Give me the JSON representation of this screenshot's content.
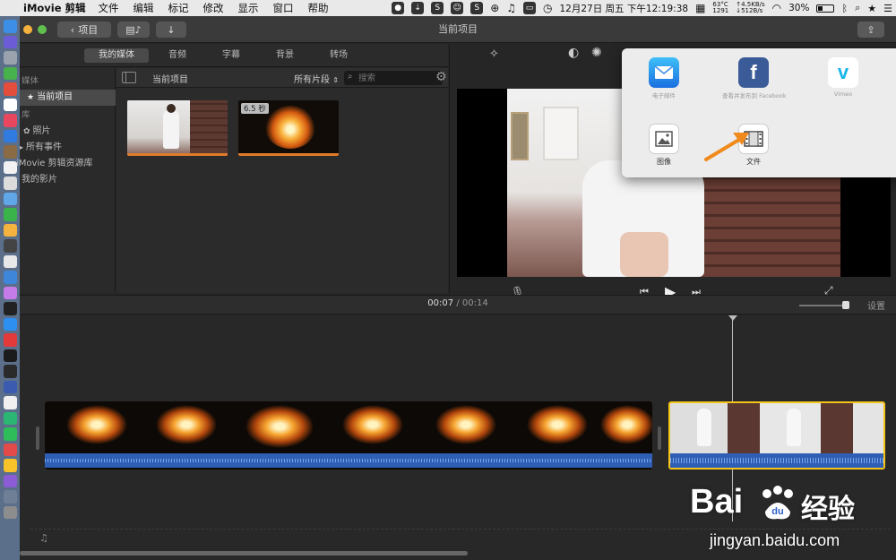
{
  "menubar": {
    "app_name": "iMovie 剪辑",
    "menus": [
      "文件",
      "编辑",
      "标记",
      "修改",
      "显示",
      "窗口",
      "帮助"
    ],
    "temperature": "63°C",
    "fan": "1291",
    "net_up": "↑4.5KB/s",
    "net_down": "↓512B/s",
    "battery": "30%",
    "clock": "12月27日 周五 下午12:19:38"
  },
  "toolbar": {
    "back_label": "项目",
    "window_title": "当前项目"
  },
  "media_tabs": [
    "我的媒体",
    "音频",
    "字幕",
    "背景",
    "转场"
  ],
  "library": {
    "section_media": "媒体",
    "current_project": "当前项目",
    "section_library": "库",
    "photos": "照片",
    "all_events": "所有事件",
    "imovie_library": "iMovie 剪辑资源库",
    "my_movies": "我的影片"
  },
  "browser": {
    "title": "当前项目",
    "filter": "所有片段",
    "search_placeholder": "搜索",
    "clip2_badge": "6.5 秒"
  },
  "share_popover": {
    "options": [
      {
        "label": "电子邮件",
        "icon": "mail-icon"
      },
      {
        "label": "查看并发布到 Facebook",
        "icon": "facebook-icon"
      },
      {
        "label": "Vimeo",
        "icon": "vimeo-icon"
      },
      {
        "label": "图像",
        "icon": "image-icon"
      },
      {
        "label": "文件",
        "icon": "film-file-icon"
      }
    ]
  },
  "timeline": {
    "current_time": "00:07",
    "separator": "/",
    "total_time": "00:14",
    "settings_label": "设置"
  },
  "watermark": {
    "brand": "Bai",
    "brand_cn": "经验",
    "url": "jingyan.baidu.com"
  },
  "colors": {
    "accent_orange": "#e07b2a",
    "selected_clip_yellow": "#f5c518",
    "audio_blue": "#2f5fb5",
    "baidu_blue": "#2a5fc9"
  }
}
